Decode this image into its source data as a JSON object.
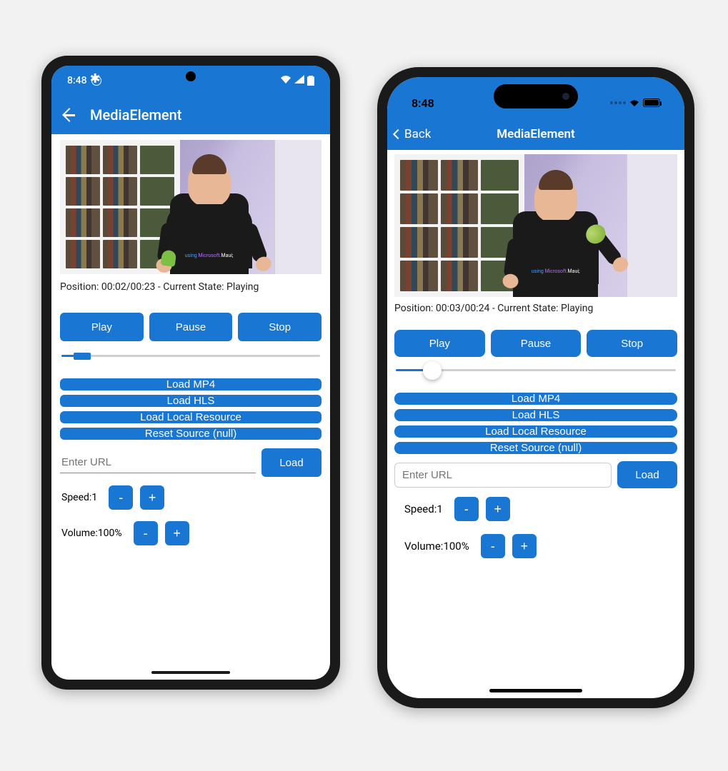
{
  "android": {
    "status": {
      "time": "8:48"
    },
    "nav": {
      "title": "MediaElement"
    },
    "video": {
      "shirt_using": "using ",
      "shirt_ms": "Microsoft.",
      "shirt_maui": "Maui;"
    },
    "position": "Position: 00:02/00:23 - Current State: Playing",
    "buttons": {
      "play": "Play",
      "pause": "Pause",
      "stop": "Stop"
    },
    "seek_pct": 8,
    "loads": {
      "mp4": "Load MP4",
      "hls": "Load HLS",
      "local": "Load Local Resource",
      "reset": "Reset Source (null)"
    },
    "url": {
      "placeholder": "Enter URL",
      "load": "Load"
    },
    "speed": {
      "label": "Speed:",
      "value": "1",
      "minus": "-",
      "plus": "+"
    },
    "volume": {
      "label": "Volume:",
      "value": "100%",
      "minus": "-",
      "plus": "+"
    }
  },
  "ios": {
    "status": {
      "time": "8:48"
    },
    "nav": {
      "back": "Back",
      "title": "MediaElement"
    },
    "video": {
      "shirt_using": "using ",
      "shirt_ms": "Microsoft.",
      "shirt_maui": "Maui;"
    },
    "position": "Position: 00:03/00:24 - Current State: Playing",
    "buttons": {
      "play": "Play",
      "pause": "Pause",
      "stop": "Stop"
    },
    "seek_pct": 13,
    "loads": {
      "mp4": "Load MP4",
      "hls": "Load HLS",
      "local": "Load Local Resource",
      "reset": "Reset Source (null)"
    },
    "url": {
      "placeholder": "Enter URL",
      "load": "Load"
    },
    "speed": {
      "label": "Speed:",
      "value": "1",
      "minus": "-",
      "plus": "+"
    },
    "volume": {
      "label": "Volume:",
      "value": "100%",
      "minus": "-",
      "plus": "+"
    }
  }
}
